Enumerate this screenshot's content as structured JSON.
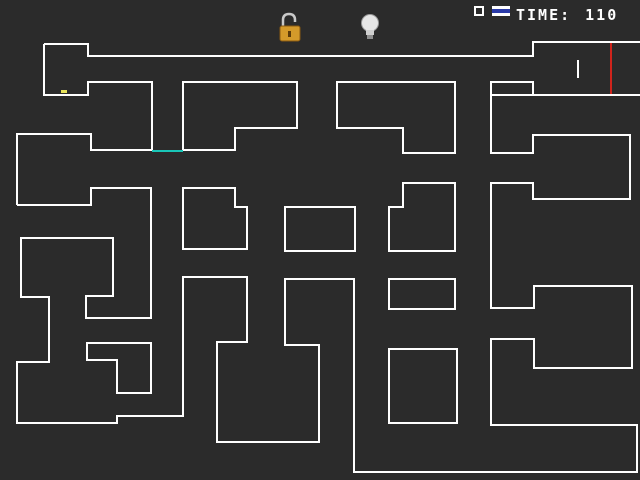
{
  "hud": {
    "time_label": "TIME:",
    "time_value": "110",
    "counter_icon": "ring-icon",
    "flag_icon": "flag-icon"
  },
  "items": {
    "lock": {
      "icon": "open-padlock-icon",
      "state": "unlocked"
    },
    "hint": {
      "icon": "lightbulb-icon",
      "state": "off"
    }
  },
  "colors": {
    "background": "#2b2b2b",
    "wall": "#ffffff",
    "door": "#19c6b8",
    "exit_line": "#d0241c",
    "player": "#e8e35a",
    "lock_body": "#d49a2a",
    "flag_blue": "#2a3aa8"
  }
}
